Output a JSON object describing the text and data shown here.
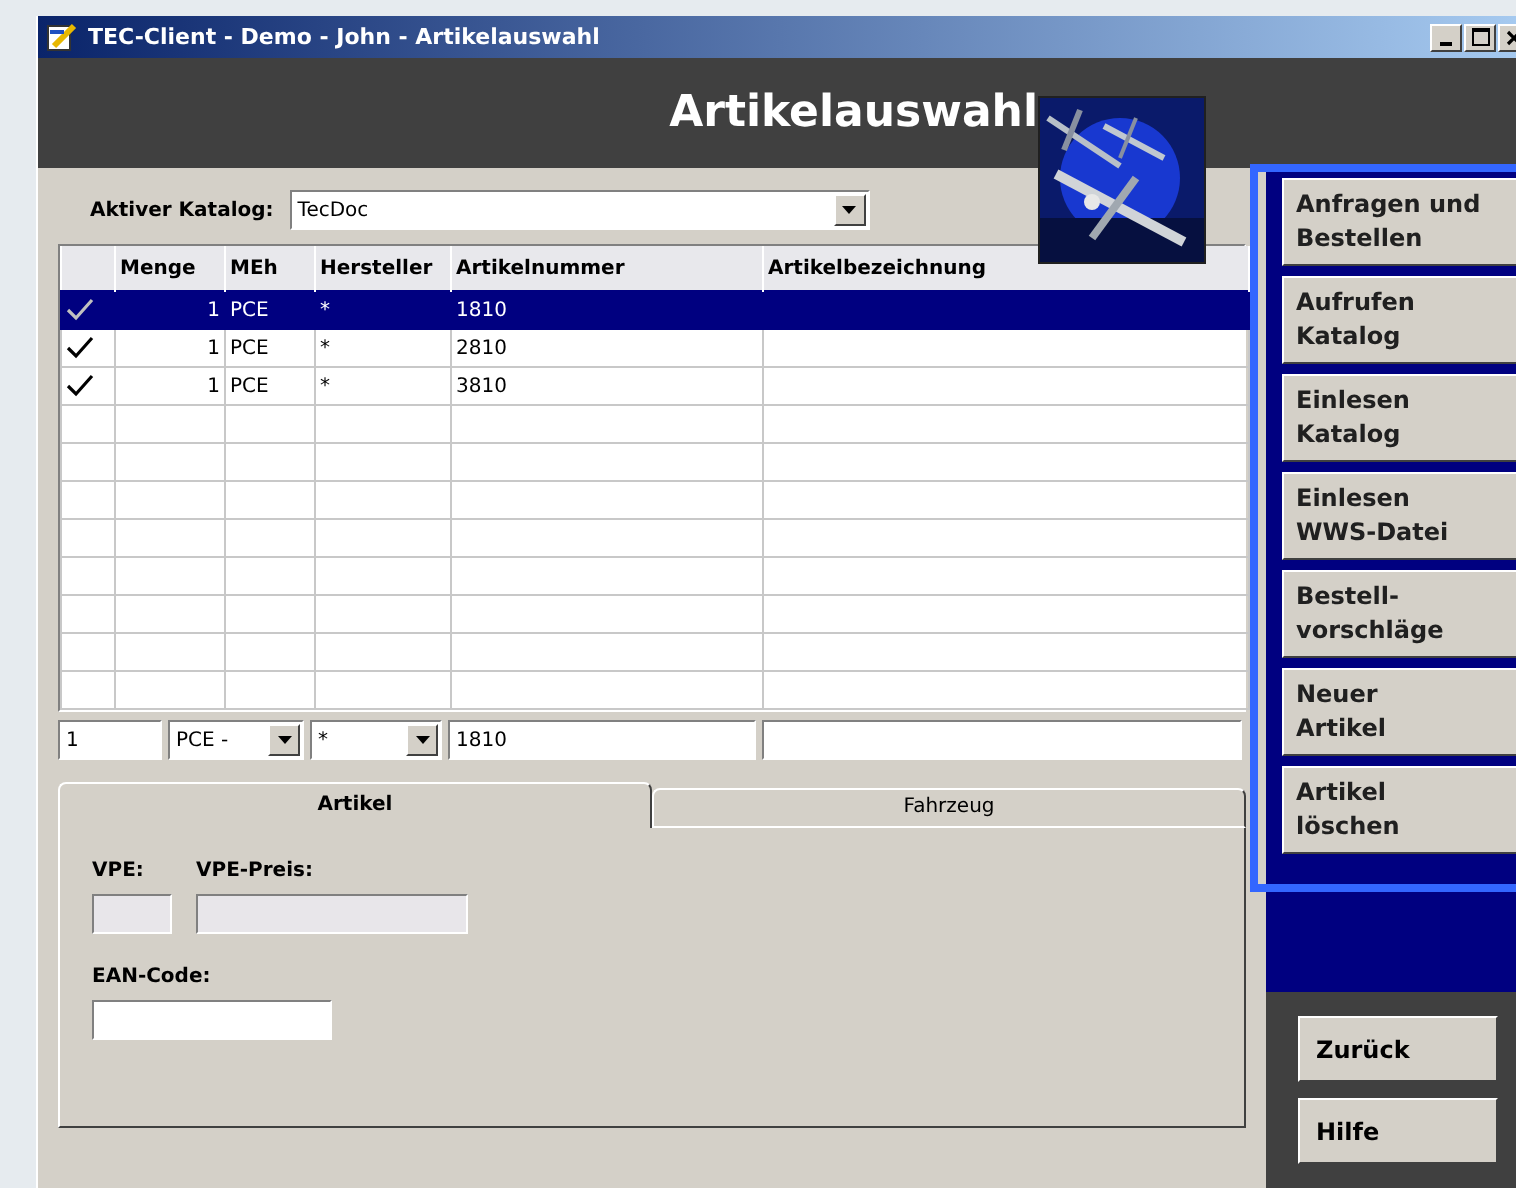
{
  "window": {
    "title": "TEC-Client - Demo - John - Artikelauswahl"
  },
  "header": {
    "title": "Artikelauswahl"
  },
  "catalog": {
    "label": "Aktiver Katalog:",
    "value": "TecDoc"
  },
  "table": {
    "columns": [
      "Menge",
      "MEh",
      "Hersteller",
      "Artikelnummer",
      "Artikelbezeichnung"
    ],
    "rows": [
      {
        "checked": true,
        "selected": true,
        "cells": [
          "1",
          "PCE",
          "*",
          "1810"
        ]
      },
      {
        "checked": true,
        "selected": false,
        "cells": [
          "1",
          "PCE",
          "*",
          "2810"
        ]
      },
      {
        "checked": true,
        "selected": false,
        "cells": [
          "1",
          "PCE",
          "*",
          "3810"
        ]
      }
    ]
  },
  "edit_row": {
    "quantity": "1",
    "unit": "PCE -",
    "manufacturer": "*",
    "article_number": "1810"
  },
  "tabs": [
    {
      "label": "Artikel",
      "selected": true
    },
    {
      "label": "Fahrzeug",
      "selected": false
    }
  ],
  "fields": [
    {
      "label": "VPE:",
      "disabled": true
    },
    {
      "label": "VPE-Preis:",
      "disabled": true
    },
    {
      "label": "EAN-Code:",
      "disabled": false
    }
  ],
  "sidebar": {
    "buttons": [
      [
        "Anfragen und",
        "Bestellen"
      ],
      [
        "Aufrufen",
        "Katalog"
      ],
      [
        "Einlesen",
        "Katalog"
      ],
      [
        "Einlesen",
        "WWS-Datei"
      ],
      [
        "Bestell-",
        "vorschläge"
      ],
      [
        "Neuer",
        "Artikel"
      ],
      [
        "Artikel",
        "löschen"
      ]
    ]
  },
  "footer_buttons": [
    "Zurück",
    "Hilfe"
  ]
}
